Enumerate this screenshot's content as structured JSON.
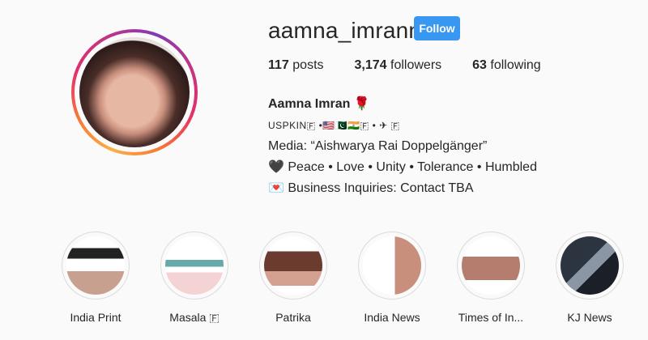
{
  "profile": {
    "username": "aamna_imrann",
    "follow_label": "Follow",
    "stats": {
      "posts_count": "117",
      "posts_label": "posts",
      "followers_count": "3,174",
      "followers_label": "followers",
      "following_count": "63",
      "following_label": "following"
    },
    "bio": {
      "name": "Aamna Imran",
      "name_emoji": "🌹",
      "line1": "USPKIN🇫 •🇺🇸🇵🇰🇮🇳🇫 • ✈ 🇫",
      "line2": "Media: “Aishwarya Rai Doppelgänger”",
      "line3_icon": "🖤",
      "line3": "Peace • Love • Unity • Tolerance • Humbled",
      "line4_icon": "💌",
      "line4": "Business Inquiries: Contact TBA"
    }
  },
  "highlights": [
    {
      "label": "India Print",
      "icon": "highlight-cover"
    },
    {
      "label": "Masala 🇫",
      "icon": "highlight-cover"
    },
    {
      "label": "Patrika",
      "icon": "highlight-cover"
    },
    {
      "label": "India News",
      "icon": "highlight-cover"
    },
    {
      "label": "Times of In...",
      "icon": "highlight-cover"
    },
    {
      "label": "KJ News",
      "icon": "highlight-cover"
    }
  ],
  "colors": {
    "follow_button": "#3897f0",
    "background": "#fafafa"
  }
}
